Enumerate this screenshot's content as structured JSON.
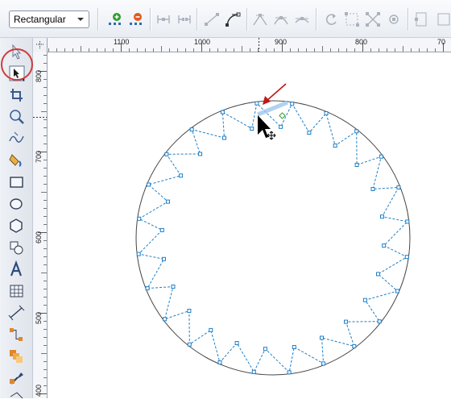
{
  "property_bar": {
    "mode_select": {
      "value": "Rectangular"
    },
    "icons": [
      "add-node-icon",
      "delete-node-icon",
      "join-nodes-icon",
      "break-curve-icon",
      "to-line-icon",
      "to-curve-icon",
      "cusp-node-icon",
      "smooth-node-icon",
      "symmetrical-node-icon",
      "reverse-direction-icon",
      "extend-curve-icon",
      "extract-subpath-icon",
      "stretch-nodes-icon",
      "elastic-mode-icon"
    ]
  },
  "toolbox": {
    "tools": [
      "pick-tool",
      "shape-tool",
      "crop-tool",
      "zoom-tool",
      "freehand-tool",
      "smart-fill-tool",
      "rectangle-tool",
      "ellipse-tool",
      "polygon-tool",
      "basic-shapes-tool",
      "text-tool",
      "table-tool",
      "dimension-tool",
      "connector-tool",
      "blend-tool",
      "eyedropper-tool",
      "fill-tool"
    ],
    "active_tool": "shape-tool"
  },
  "ruler_top": {
    "labels": [
      "1100",
      "1000",
      "900",
      "800",
      "70"
    ]
  },
  "ruler_left": {
    "labels": [
      "800",
      "700",
      "600",
      "500",
      "400"
    ]
  },
  "canvas": {
    "object": "circle-with-dashed-control-path",
    "accent_color": "#1f7fc7",
    "circle_color": "#444444",
    "arrow_color": "#c01818"
  }
}
